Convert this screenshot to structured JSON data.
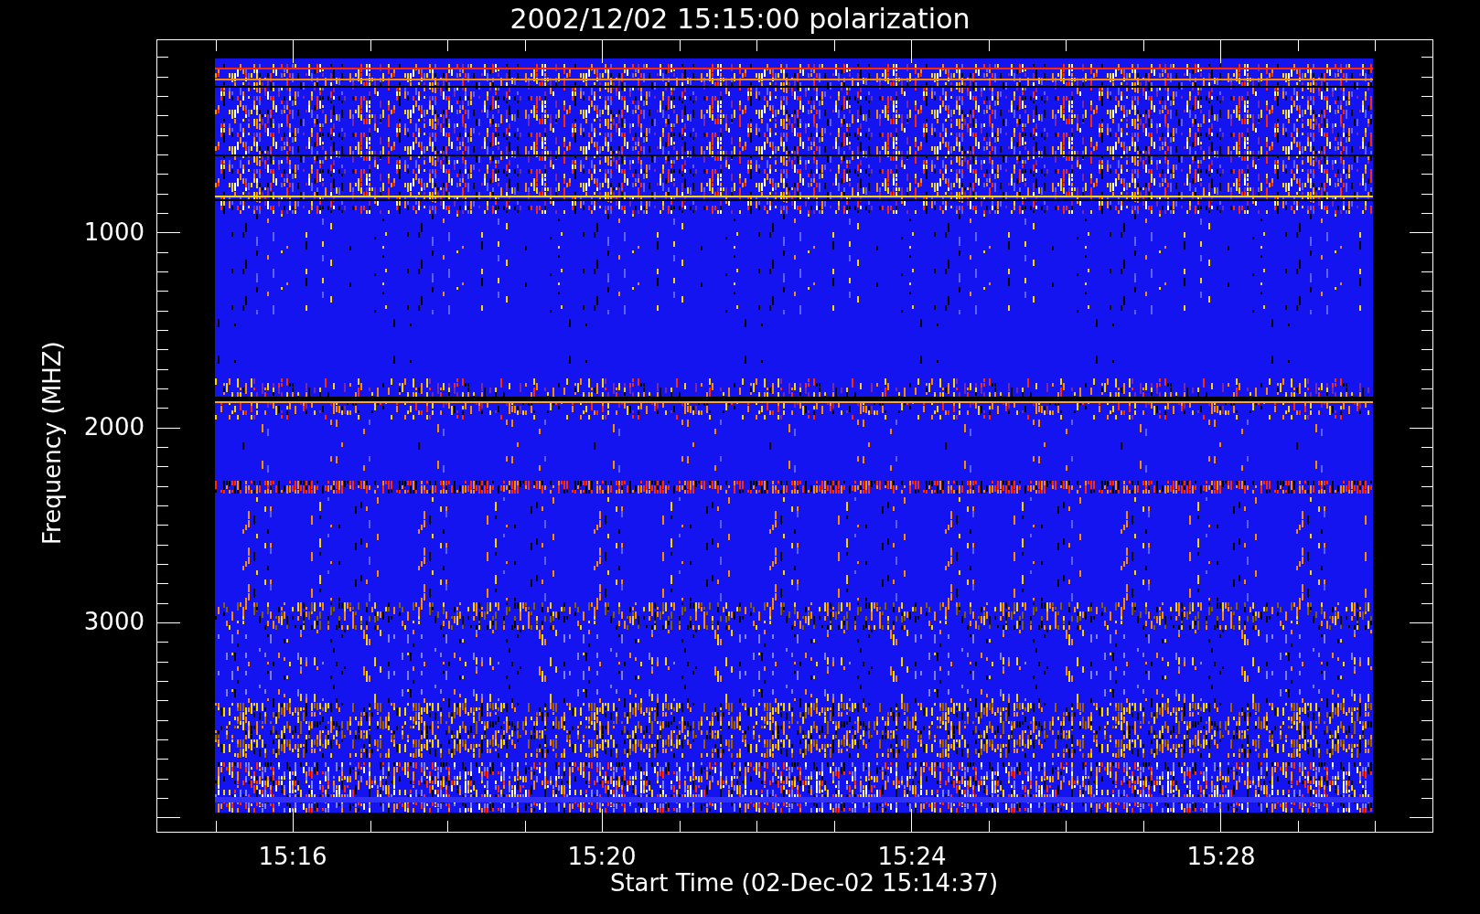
{
  "title": "2002/12/02 15:15:00 polarization",
  "plot": {
    "ylabel": "Frequency (MHZ)",
    "xlabel": "Start Time (02-Dec-02 15:14:37)",
    "yticks": [
      "1000",
      "2000",
      "3000"
    ],
    "xticks": [
      "15:16",
      "15:20",
      "15:24",
      "15:28"
    ]
  }
}
